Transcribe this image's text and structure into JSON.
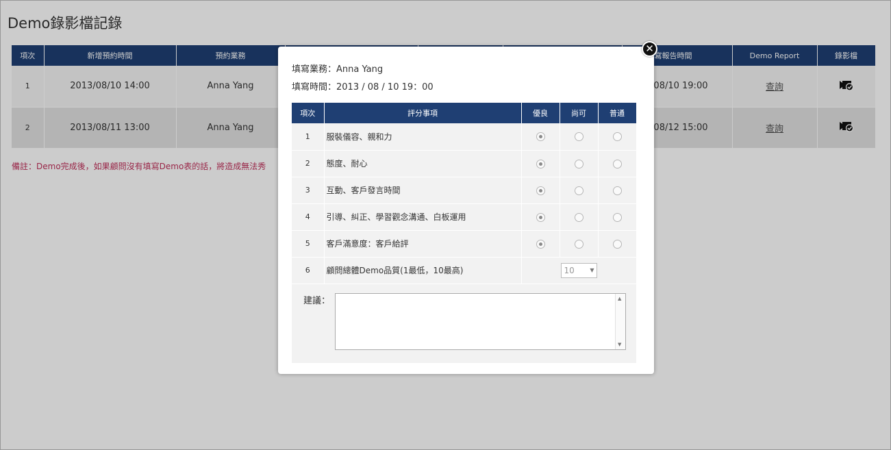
{
  "page": {
    "title": "Demo錄影檔記錄"
  },
  "main_table": {
    "headers": [
      "項次",
      "新增預約時間",
      "預約業務",
      "",
      "",
      "",
      "填寫報告時間",
      "Demo Report",
      "錄影檔"
    ],
    "rows": [
      {
        "index": "1",
        "booking_time": "2013/08/10 14:00",
        "sales": "Anna Yang",
        "report_time": "13/08/10 19:00",
        "report_link": "查詢",
        "video": "video-check-icon"
      },
      {
        "index": "2",
        "booking_time": "2013/08/11 13:00",
        "sales": "Anna Yang",
        "report_time": "13/08/12 15:00",
        "report_link": "查詢",
        "video": "video-check-icon"
      }
    ]
  },
  "note": "備註：Demo完成後，如果顧問沒有填寫Demo表的話，將造成無法秀",
  "modal": {
    "close_icon": "close-icon",
    "filler_label": "填寫業務：",
    "filler_value": "Anna Yang",
    "time_label": "填寫時間：",
    "time_value": "2013 / 08 / 10 19：00",
    "eval_headers": [
      "項次",
      "評分事項",
      "優良",
      "尚可",
      "普通"
    ],
    "eval_rows": [
      {
        "num": "1",
        "item": "服裝儀容、親和力",
        "selected": "優良"
      },
      {
        "num": "2",
        "item": "態度、耐心",
        "selected": "優良"
      },
      {
        "num": "3",
        "item": "互動、客戶發言時間",
        "selected": "優良"
      },
      {
        "num": "4",
        "item": "引導、糾正、學習觀念溝通、白板運用",
        "selected": "優良"
      },
      {
        "num": "5",
        "item": "客戶滿意度：客戶給評",
        "selected": "優良"
      }
    ],
    "quality_row": {
      "num": "6",
      "item": "顧問總體Demo品質(1最低，10最高)",
      "value": "10"
    },
    "suggest_label": "建議：",
    "suggest_value": ""
  },
  "colors": {
    "header_bg": "#1f3f73",
    "note": "#c0305a"
  }
}
